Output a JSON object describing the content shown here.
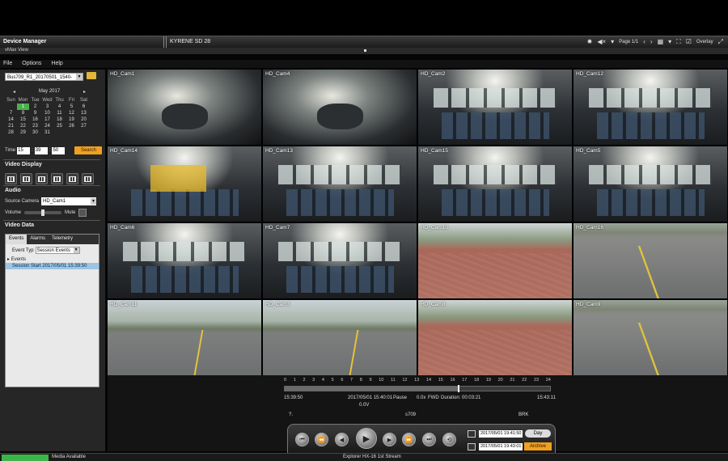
{
  "titlebar": {
    "left": "Device Manager",
    "center": "KYRENE SD 28",
    "page": "Page 1/1",
    "overlay": "Overlay"
  },
  "subbar": {
    "label": "vMax View"
  },
  "menu": [
    "File",
    "Options",
    "Help"
  ],
  "left": {
    "file": "Bus709_R1_20170501_1540-",
    "calendar": {
      "month": "May 2017",
      "dow": [
        "Sun",
        "Mon",
        "Tue",
        "Wed",
        "Thu",
        "Fri",
        "Sat"
      ],
      "days": [
        "",
        "1",
        "2",
        "3",
        "4",
        "5",
        "6",
        "7",
        "8",
        "9",
        "10",
        "11",
        "12",
        "13",
        "14",
        "15",
        "16",
        "17",
        "18",
        "19",
        "20",
        "21",
        "22",
        "23",
        "24",
        "25",
        "26",
        "27",
        "28",
        "29",
        "30",
        "31",
        "",
        "",
        ""
      ],
      "selected": "1"
    },
    "time": {
      "label": "Time",
      "h": "15",
      "m": "39",
      "s": "50",
      "search": "Search"
    },
    "video_display": "Video Display",
    "audio": "Audio",
    "source_label": "Source Camera",
    "source_value": "HD_Cam1",
    "volume": "Volume",
    "volume_level": 0.45,
    "mute": "Mute",
    "video_data": "Video Data",
    "tabs": [
      "Events",
      "Alarms",
      "Telemetry"
    ],
    "event_type_label": "Event Typ",
    "event_type_value": "Session Events",
    "tree_head": "Events",
    "event_item": "Session Start 2017/05/01 15:39:50"
  },
  "cameras": [
    {
      "label": "HD_Cam1",
      "scene": "cab"
    },
    {
      "label": "HD_Cam4",
      "scene": "cab"
    },
    {
      "label": "HD_Cam2",
      "scene": "interior"
    },
    {
      "label": "HD_Cam12",
      "scene": "interior"
    },
    {
      "label": "HD_Cam14",
      "scene": "interior"
    },
    {
      "label": "HD_Cam13",
      "scene": "interior"
    },
    {
      "label": "HD_Cam15",
      "scene": "interior"
    },
    {
      "label": "HD_Cam5",
      "scene": "interior"
    },
    {
      "label": "HD_Cam6",
      "scene": "interior"
    },
    {
      "label": "HD_Cam7",
      "scene": "interior"
    },
    {
      "label": "HD_Cam10",
      "scene": "brick"
    },
    {
      "label": "HD_Cam16",
      "scene": "road"
    },
    {
      "label": "HD_Cam11",
      "scene": "street"
    },
    {
      "label": "HD_Cam3",
      "scene": "street"
    },
    {
      "label": "HD_Cam8",
      "scene": "brick"
    },
    {
      "label": "HD_Cam9",
      "scene": "road"
    }
  ],
  "timeline": {
    "ticks": [
      "0",
      "1",
      "2",
      "3",
      "4",
      "5",
      "6",
      "7",
      "8",
      "9",
      "10",
      "11",
      "12",
      "13",
      "14",
      "15",
      "16",
      "17",
      "18",
      "19",
      "20",
      "21",
      "22",
      "23",
      "24"
    ],
    "position_hours": 15.65,
    "start": "15:39:50",
    "current": "2017/05/01 15:40:01",
    "state": "Pause",
    "speed": "0.0x",
    "direction": "FWD",
    "duration": "Duration: 00:03:21",
    "end": "15:43:11",
    "voltage": "0.0V",
    "q": "?.",
    "unit": "s709",
    "brk": "BRK"
  },
  "controls": {
    "start_dt": "2017/05/01 19:41:50",
    "end_dt": "2017/05/01 19:43:01",
    "range": "Day",
    "archive": "Archive"
  },
  "status": {
    "left": "Media Available",
    "center": "Explorer HX-16 1st Stream",
    "progress": 1.0
  },
  "colors": {
    "accent": "#f0a020",
    "selected_day": "#4caf50",
    "event_highlight": "#9cc4e4"
  }
}
